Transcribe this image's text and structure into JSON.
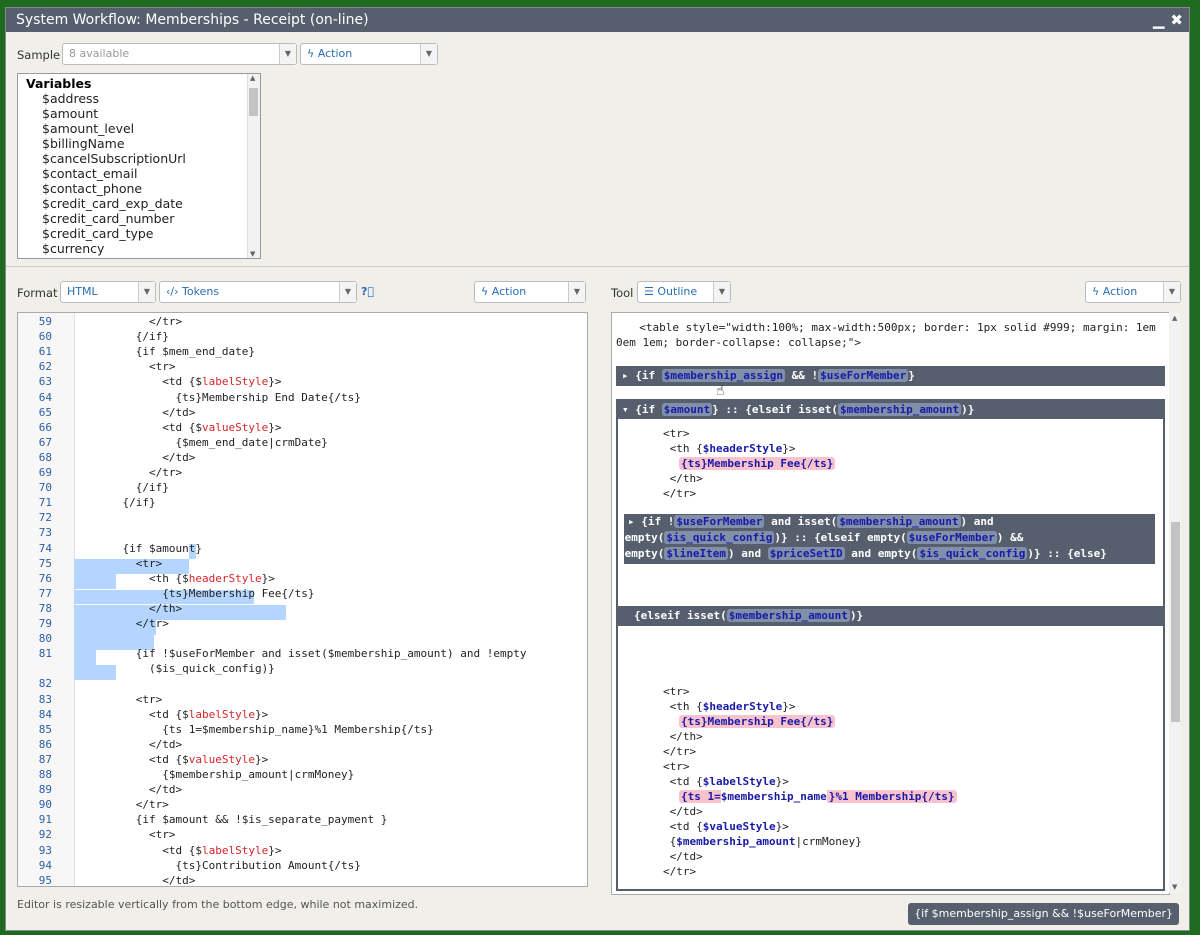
{
  "window": {
    "title": "System Workflow: Memberships - Receipt (on-line)",
    "min_icon": "minimize-icon",
    "close_icon": "close-icon"
  },
  "sample": {
    "label": "Sample",
    "select_value": "8 available",
    "action_label": "Action"
  },
  "variables": {
    "header": "Variables",
    "items": [
      "$address",
      "$amount",
      "$amount_level",
      "$billingName",
      "$cancelSubscriptionUrl",
      "$contact_email",
      "$contact_phone",
      "$credit_card_exp_date",
      "$credit_card_number",
      "$credit_card_type",
      "$currency"
    ]
  },
  "format": {
    "label": "Format",
    "value": "HTML",
    "tokens_label": "Tokens",
    "help_icon": "help-icon",
    "action_label": "Action"
  },
  "tool": {
    "label": "Tool",
    "value": "Outline",
    "action_label": "Action"
  },
  "editor": {
    "lines": [
      {
        "n": "59",
        "t": "        </tr>"
      },
      {
        "n": "60",
        "t": "      {/if}"
      },
      {
        "n": "61",
        "t": "      {if $mem_end_date}"
      },
      {
        "n": "62",
        "t": "        <tr>"
      },
      {
        "n": "63",
        "t": "          <td {$labelStyle}>"
      },
      {
        "n": "64",
        "t": "            {ts}Membership End Date{/ts}"
      },
      {
        "n": "65",
        "t": "          </td>"
      },
      {
        "n": "66",
        "t": "          <td {$valueStyle}>"
      },
      {
        "n": "67",
        "t": "            {$mem_end_date|crmDate}"
      },
      {
        "n": "68",
        "t": "          </td>"
      },
      {
        "n": "69",
        "t": "        </tr>"
      },
      {
        "n": "70",
        "t": "      {/if}"
      },
      {
        "n": "71",
        "t": "    {/if}"
      },
      {
        "n": "72",
        "t": ""
      },
      {
        "n": "73",
        "t": ""
      },
      {
        "n": "74",
        "t": "    {if $amount}"
      },
      {
        "n": "75",
        "t": "      <tr>"
      },
      {
        "n": "76",
        "t": "        <th {$headerStyle}>"
      },
      {
        "n": "77",
        "t": "          {ts}Membership Fee{/ts}"
      },
      {
        "n": "78",
        "t": "        </th>"
      },
      {
        "n": "79",
        "t": "      </tr>"
      },
      {
        "n": "80",
        "t": ""
      },
      {
        "n": "81",
        "t": "      {if !$useForMember and isset($membership_amount) and !empty"
      },
      {
        "n": "",
        "t": "        ($is_quick_config)}"
      },
      {
        "n": "82",
        "t": ""
      },
      {
        "n": "83",
        "t": "      <tr>"
      },
      {
        "n": "84",
        "t": "        <td {$labelStyle}>"
      },
      {
        "n": "85",
        "t": "          {ts 1=$membership_name}%1 Membership{/ts}"
      },
      {
        "n": "86",
        "t": "        </td>"
      },
      {
        "n": "87",
        "t": "        <td {$valueStyle}>"
      },
      {
        "n": "88",
        "t": "          {$membership_amount|crmMoney}"
      },
      {
        "n": "89",
        "t": "        </td>"
      },
      {
        "n": "90",
        "t": "      </tr>"
      },
      {
        "n": "91",
        "t": "      {if $amount && !$is_separate_payment }"
      },
      {
        "n": "92",
        "t": "        <tr>"
      },
      {
        "n": "93",
        "t": "          <td {$labelStyle}>"
      },
      {
        "n": "94",
        "t": "            {ts}Contribution Amount{/ts}"
      },
      {
        "n": "95",
        "t": "          </td>"
      }
    ]
  },
  "outline": {
    "intro_1": "  <table style=\"width:100%; max-width:500px; border: 1px solid #999; margin: 1em",
    "intro_2": "0em 1em; border-collapse: collapse;\">",
    "bar1": {
      "pre": "▸ {if ",
      "tok1": "$membership_assign",
      "mid": " && !",
      "tok2": "$useForMember",
      "post": "}"
    },
    "bar2": {
      "pre": "▾ {if ",
      "tok1": "$amount",
      "mid": "} :: {elseif isset(",
      "tok2": "$membership_amount",
      "post": ")}"
    },
    "block2": [
      "<tr>",
      " <th {",
      "$headerStyle",
      "}>",
      "{ts}Membership Fee{/ts}",
      " </th>",
      "</tr>"
    ],
    "bar3_l1": {
      "a": "▸ {if !",
      "t1": "$useForMember",
      "b": " and isset(",
      "t2": "$membership_amount",
      "c": ") and"
    },
    "bar3_l2": {
      "a": "!empty(",
      "t1": "$is_quick_config",
      "b": ")} :: {elseif empty(",
      "t2": "$useForMember",
      "c": ") &&"
    },
    "bar3_l3": {
      "a": "!empty(",
      "t1": "$lineItem",
      "b": ") and ",
      "t2": "$priceSetID",
      "c": " and empty(",
      "t3": "$is_quick_config",
      "d": ")} :: {else}"
    },
    "bar4": {
      "pre": "{elseif isset(",
      "tok": "$membership_amount",
      "post": ")}"
    },
    "block4": {
      "tr": "<tr>",
      "th_open": " <th {",
      "header_style": "$headerStyle",
      "th_close": "}>",
      "fee": "{ts}Membership Fee{/ts}",
      "th_end": " </th>",
      "tr_end": "</tr>",
      "tr2": "<tr>",
      "td_open": " <td {",
      "label_style": "$labelStyle",
      "td_close": "}>",
      "ts1": "{ts 1=",
      "mname": "$membership_name",
      "ts_rest": "}%1 Membership{/ts}",
      "td_end": " </td>",
      "td2_open": " <td {",
      "value_style": "$valueStyle",
      "td2_close": "}>",
      "mamt_open": " {",
      "mamt": "$membership_amount",
      "mamt_rest": "|crmMoney}",
      "td2_end": " </td>",
      "tr2_end": "</tr>"
    }
  },
  "status": "Editor is resizable vertically from the bottom edge, while not maximized.",
  "breadcrumb": "{if $membership_assign && !$useForMember}"
}
